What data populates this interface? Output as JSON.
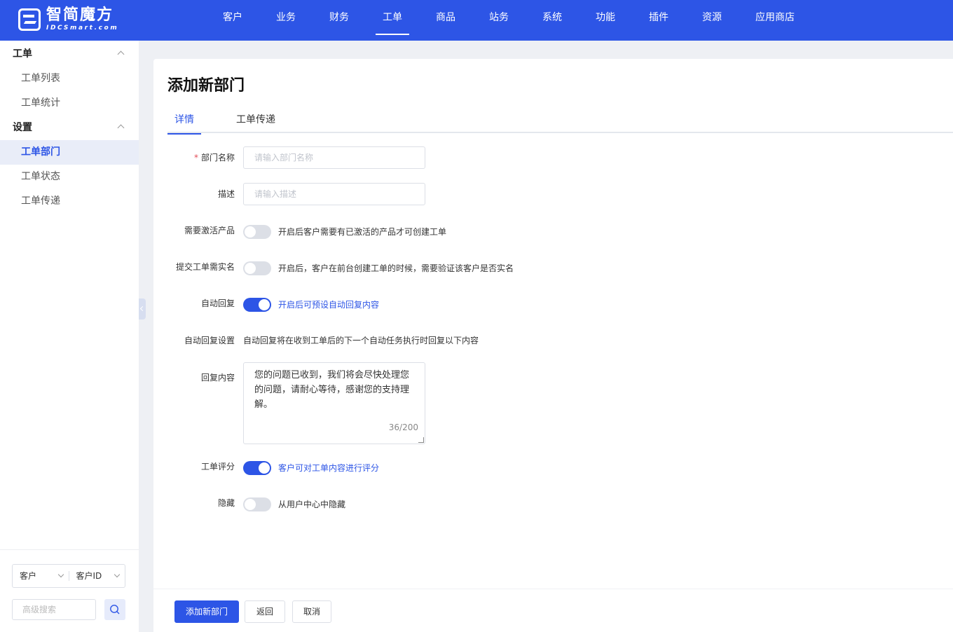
{
  "brand": {
    "name_cn": "智简魔方",
    "name_en": "IDCSmart.com"
  },
  "nav": {
    "items": [
      {
        "label": "客户"
      },
      {
        "label": "业务"
      },
      {
        "label": "财务"
      },
      {
        "label": "工单"
      },
      {
        "label": "商品"
      },
      {
        "label": "站务"
      },
      {
        "label": "系统"
      },
      {
        "label": "功能"
      },
      {
        "label": "插件"
      },
      {
        "label": "资源"
      },
      {
        "label": "应用商店"
      }
    ],
    "active": "工单"
  },
  "sidebar": {
    "groups": [
      {
        "title": "工单",
        "items": [
          {
            "label": "工单列表"
          },
          {
            "label": "工单统计"
          }
        ]
      },
      {
        "title": "设置",
        "items": [
          {
            "label": "工单部门"
          },
          {
            "label": "工单状态"
          },
          {
            "label": "工单传递"
          }
        ]
      }
    ],
    "active_item": "工单部门",
    "search": {
      "select_type": "客户",
      "select_field": "客户ID",
      "placeholder": "高级搜索"
    }
  },
  "page": {
    "title": "添加新部门",
    "tabs": [
      {
        "label": "详情"
      },
      {
        "label": "工单传递"
      }
    ],
    "active_tab": "详情"
  },
  "form": {
    "name": {
      "label": "部门名称",
      "required_mark": "*",
      "placeholder": "请输入部门名称",
      "value": ""
    },
    "description": {
      "label": "描述",
      "placeholder": "请输入描述",
      "value": ""
    },
    "require_active_product": {
      "label": "需要激活产品",
      "on": false,
      "desc": "开启后客户需要有已激活的产品才可创建工单"
    },
    "require_real_name": {
      "label": "提交工单需实名",
      "on": false,
      "desc": "开启后，客户在前台创建工单的时候，需要验证该客户是否实名"
    },
    "auto_reply": {
      "label": "自动回复",
      "on": true,
      "desc": "开启后可预设自动回复内容"
    },
    "auto_reply_setting": {
      "label": "自动回复设置",
      "text": "自动回复将在收到工单后的下一个自动任务执行时回复以下内容"
    },
    "reply_content": {
      "label": "回复内容",
      "value": "您的问题已收到，我们将会尽快处理您的问题，请耐心等待，感谢您的支持理解。",
      "counter": "36/200"
    },
    "rating": {
      "label": "工单评分",
      "on": true,
      "desc": "客户可对工单内容进行评分"
    },
    "hidden": {
      "label": "隐藏",
      "on": false,
      "desc": "从用户中心中隐藏"
    }
  },
  "footer": {
    "submit_label": "添加新部门",
    "back_label": "返回",
    "cancel_label": "取消"
  },
  "colors": {
    "primary": "#2d55e6",
    "required": "#e34d59"
  }
}
